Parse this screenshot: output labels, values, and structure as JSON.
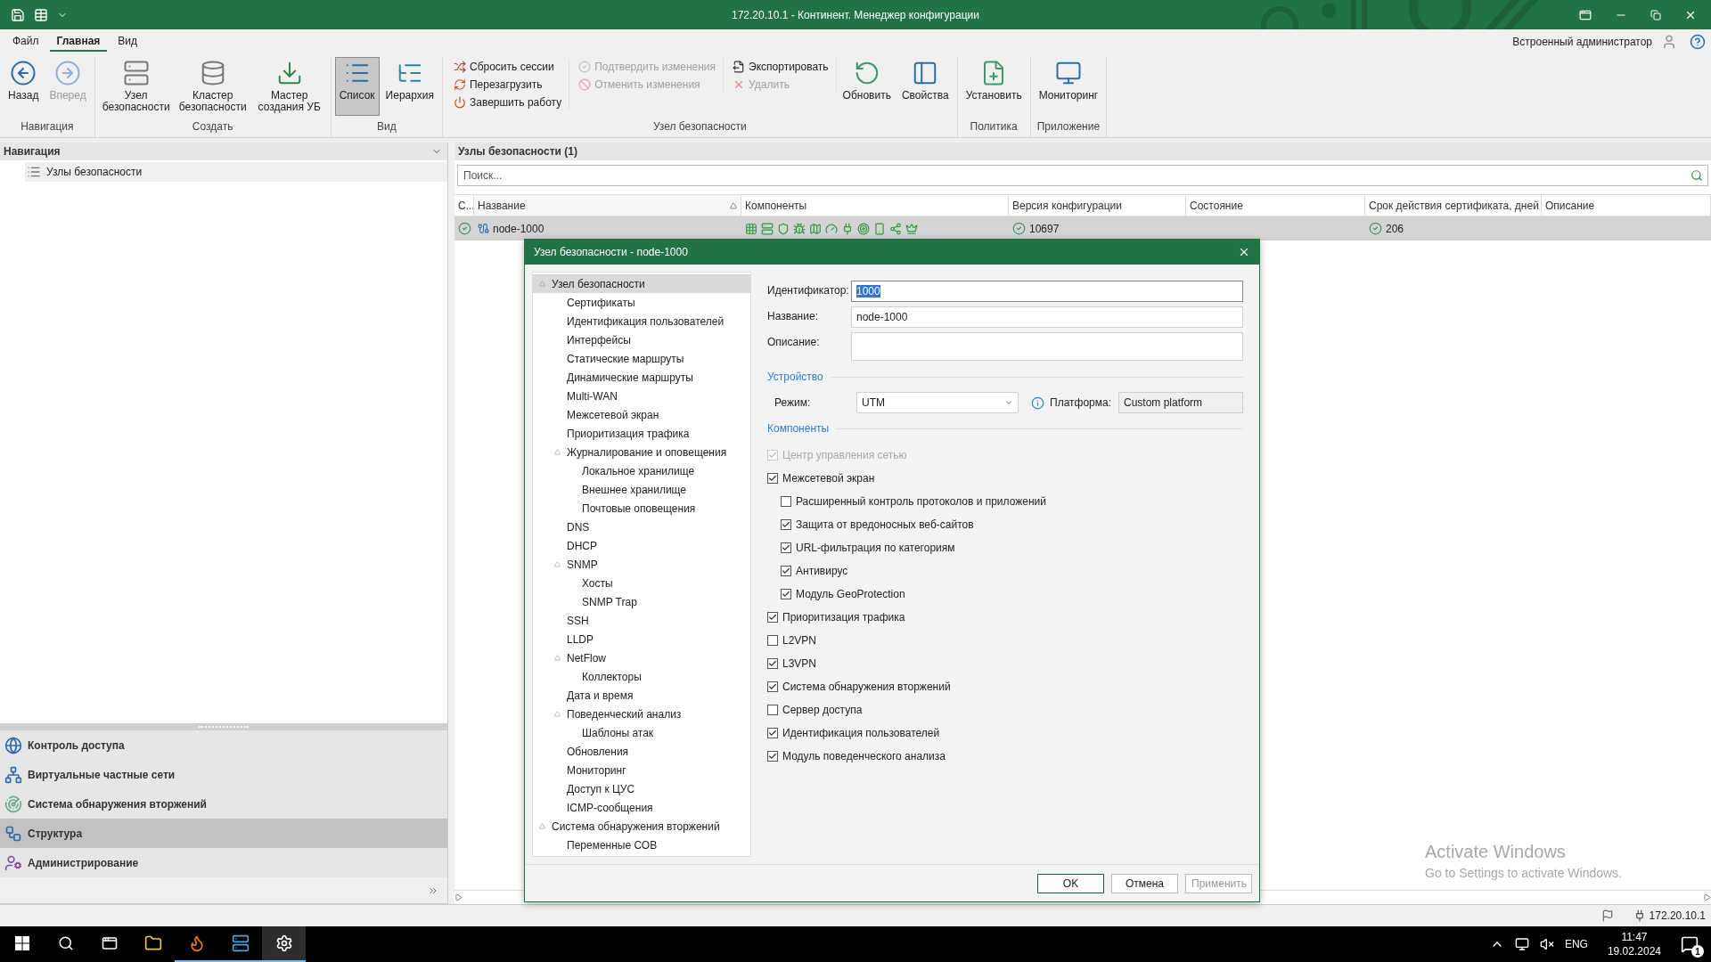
{
  "title_bar": {
    "title": "172.20.10.1 - Континент. Менеджер конфигурации"
  },
  "ribbon": {
    "tabs": [
      {
        "label": "Файл",
        "selected": false
      },
      {
        "label": "Главная",
        "selected": true
      },
      {
        "label": "Вид",
        "selected": false
      }
    ],
    "user": "Встроенный администратор",
    "groups": [
      {
        "label": "Навигация",
        "items": [
          {
            "kind": "large",
            "label": "Назад",
            "disabled": false
          },
          {
            "kind": "large",
            "label": "Вперед",
            "disabled": true
          }
        ]
      },
      {
        "label": "Создать",
        "items": [
          {
            "kind": "large",
            "label": "Узел безопасности",
            "disabled": false
          },
          {
            "kind": "large",
            "label": "Кластер безопасности",
            "disabled": false
          },
          {
            "kind": "large",
            "label": "Мастер создания УБ",
            "disabled": false
          }
        ]
      },
      {
        "label": "Вид",
        "items": [
          {
            "kind": "large",
            "label": "Список",
            "disabled": false,
            "selected": true
          },
          {
            "kind": "large",
            "label": "Иерархия",
            "disabled": false,
            "selected": false
          }
        ]
      },
      {
        "label": "Узел безопасности",
        "items": [
          {
            "kind": "stack",
            "items": [
              {
                "label": "Сбросить сессии",
                "disabled": false
              },
              {
                "label": "Перезагрузить",
                "disabled": false
              },
              {
                "label": "Завершить работу",
                "disabled": false
              }
            ]
          },
          {
            "kind": "stack",
            "items": [
              {
                "label": "Подтвердить изменения",
                "disabled": true
              },
              {
                "label": "Отменить изменения",
                "disabled": true
              }
            ]
          },
          {
            "kind": "stack",
            "items": [
              {
                "label": "Экспортировать",
                "disabled": false
              },
              {
                "label": "Удалить",
                "disabled": true
              }
            ]
          },
          {
            "kind": "large",
            "label": "Обновить",
            "disabled": false
          },
          {
            "kind": "large",
            "label": "Свойства",
            "disabled": false
          }
        ]
      },
      {
        "label": "Политика",
        "items": [
          {
            "kind": "large",
            "label": "Установить",
            "disabled": false
          }
        ]
      },
      {
        "label": "Приложение",
        "items": [
          {
            "kind": "large",
            "label": "Мониторинг",
            "disabled": false
          }
        ]
      }
    ]
  },
  "navigation": {
    "title": "Навигация",
    "items": [
      {
        "label": "Узлы безопасности",
        "selected": true
      }
    ],
    "sections": [
      {
        "label": "Контроль доступа",
        "selected": false
      },
      {
        "label": "Виртуальные частные сети",
        "selected": false
      },
      {
        "label": "Система обнаружения вторжений",
        "selected": false
      },
      {
        "label": "Структура",
        "selected": true
      },
      {
        "label": "Администрирование",
        "selected": false
      }
    ]
  },
  "content": {
    "title": "Узлы безопасности (1)",
    "search": {
      "placeholder": "Поиск..."
    },
    "columns": [
      {
        "label": "С...",
        "sorted": false
      },
      {
        "label": "Название",
        "sorted": true
      },
      {
        "label": "Компоненты",
        "sorted": false
      },
      {
        "label": "Версия конфигурации",
        "sorted": false
      },
      {
        "label": "Состояние",
        "sorted": false
      },
      {
        "label": "Срок действия сертификата, дней",
        "sorted": false
      },
      {
        "label": "Описание",
        "sorted": false
      }
    ],
    "rows": [
      {
        "selected": true,
        "name": "node-1000",
        "version": "10697",
        "cert_days": "206"
      }
    ]
  },
  "dialog": {
    "title": "Узел безопасности - node-1000",
    "tree": [
      {
        "label": "Узел безопасности",
        "selected": true,
        "expanded": true,
        "children": [
          {
            "label": "Сертификаты",
            "selected": false
          },
          {
            "label": "Идентификация пользователей",
            "selected": false
          },
          {
            "label": "Интерфейсы",
            "selected": false
          },
          {
            "label": "Статические маршруты",
            "selected": false
          },
          {
            "label": "Динамические маршруты",
            "selected": false
          },
          {
            "label": "Multi-WAN",
            "selected": false
          },
          {
            "label": "Межсетевой экран",
            "selected": false
          },
          {
            "label": "Приоритизация трафика",
            "selected": false
          },
          {
            "label": "Журналирование и оповещения",
            "selected": false,
            "expanded": true,
            "children": [
              {
                "label": "Локальное хранилище",
                "selected": false
              },
              {
                "label": "Внешнее хранилище",
                "selected": false
              },
              {
                "label": "Почтовые оповещения",
                "selected": false
              }
            ]
          },
          {
            "label": "DNS",
            "selected": false
          },
          {
            "label": "DHCP",
            "selected": false
          },
          {
            "label": "SNMP",
            "selected": false,
            "expanded": true,
            "children": [
              {
                "label": "Хосты",
                "selected": false
              },
              {
                "label": "SNMP Trap",
                "selected": false
              }
            ]
          },
          {
            "label": "SSH",
            "selected": false
          },
          {
            "label": "LLDP",
            "selected": false
          },
          {
            "label": "NetFlow",
            "selected": false,
            "expanded": true,
            "children": [
              {
                "label": "Коллекторы",
                "selected": false
              }
            ]
          },
          {
            "label": "Дата и время",
            "selected": false
          },
          {
            "label": "Поведенческий анализ",
            "selected": false,
            "expanded": true,
            "children": [
              {
                "label": "Шаблоны атак",
                "selected": false
              }
            ]
          },
          {
            "label": "Обновления",
            "selected": false
          },
          {
            "label": "Мониторинг",
            "selected": false
          },
          {
            "label": "Доступ к ЦУС",
            "selected": false
          },
          {
            "label": "ICMP-сообщения",
            "selected": false
          }
        ]
      },
      {
        "label": "Система обнаружения вторжений",
        "selected": false,
        "expanded": true,
        "children": [
          {
            "label": "Переменные СОВ",
            "selected": false
          }
        ]
      }
    ],
    "fields": [
      {
        "kind": "text",
        "label": "Идентификатор:",
        "value": "1000",
        "focused": true
      },
      {
        "kind": "text",
        "label": "Название:",
        "value": "node-1000",
        "focused": false
      },
      {
        "kind": "multiline",
        "label": "Описание:",
        "focused": false
      }
    ],
    "device": {
      "title": "Устройство",
      "mode_label": "Режим:",
      "mode": "UTM",
      "platform_label": "Платформа:",
      "platform": "Custom platform"
    },
    "components": {
      "title": "Компоненты",
      "items": [
        {
          "label": "Центр управления сетью",
          "checked": true,
          "disabled": true
        },
        {
          "label": "Межсетевой экран",
          "checked": true,
          "disabled": false,
          "children": [
            {
              "label": "Расширенный контроль протоколов и приложений",
              "checked": false,
              "disabled": false
            },
            {
              "label": "Защита от вредоносных веб-сайтов",
              "checked": true,
              "disabled": false
            },
            {
              "label": "URL-фильтрация по категориям",
              "checked": true,
              "disabled": false
            },
            {
              "label": "Антивирус",
              "checked": true,
              "disabled": false
            },
            {
              "label": "Модуль GeoProtection",
              "checked": true,
              "disabled": false
            }
          ]
        },
        {
          "label": "Приоритизация трафика",
          "checked": true,
          "disabled": false
        },
        {
          "label": "L2VPN",
          "checked": false,
          "disabled": false
        },
        {
          "label": "L3VPN",
          "checked": true,
          "disabled": false
        },
        {
          "label": "Система обнаружения вторжений",
          "checked": true,
          "disabled": false
        },
        {
          "label": "Сервер доступа",
          "checked": false,
          "disabled": false
        },
        {
          "label": "Идентификация пользователей",
          "checked": true,
          "disabled": false
        },
        {
          "label": "Модуль поведенческого анализа",
          "checked": true,
          "disabled": false
        }
      ]
    },
    "buttons": [
      {
        "label": "OK",
        "default": true,
        "disabled": false
      },
      {
        "label": "Отмена",
        "default": false,
        "disabled": false
      },
      {
        "label": "Применить",
        "default": false,
        "disabled": true
      }
    ]
  },
  "activation_notice": {
    "title": "Activate Windows",
    "subtitle": "Go to Settings to activate Windows."
  },
  "status_bar": {
    "address": "172.20.10.1"
  },
  "taskbar": {
    "apps": [
      {
        "running": false,
        "selected": false
      },
      {
        "running": false,
        "selected": false
      },
      {
        "running": false,
        "selected": false
      },
      {
        "running": true,
        "selected": false
      },
      {
        "running": true,
        "selected": false
      },
      {
        "running": true,
        "selected": true
      }
    ],
    "language": "ENG",
    "time": "11:47",
    "date": "19.02.2024",
    "notifications": "1"
  }
}
